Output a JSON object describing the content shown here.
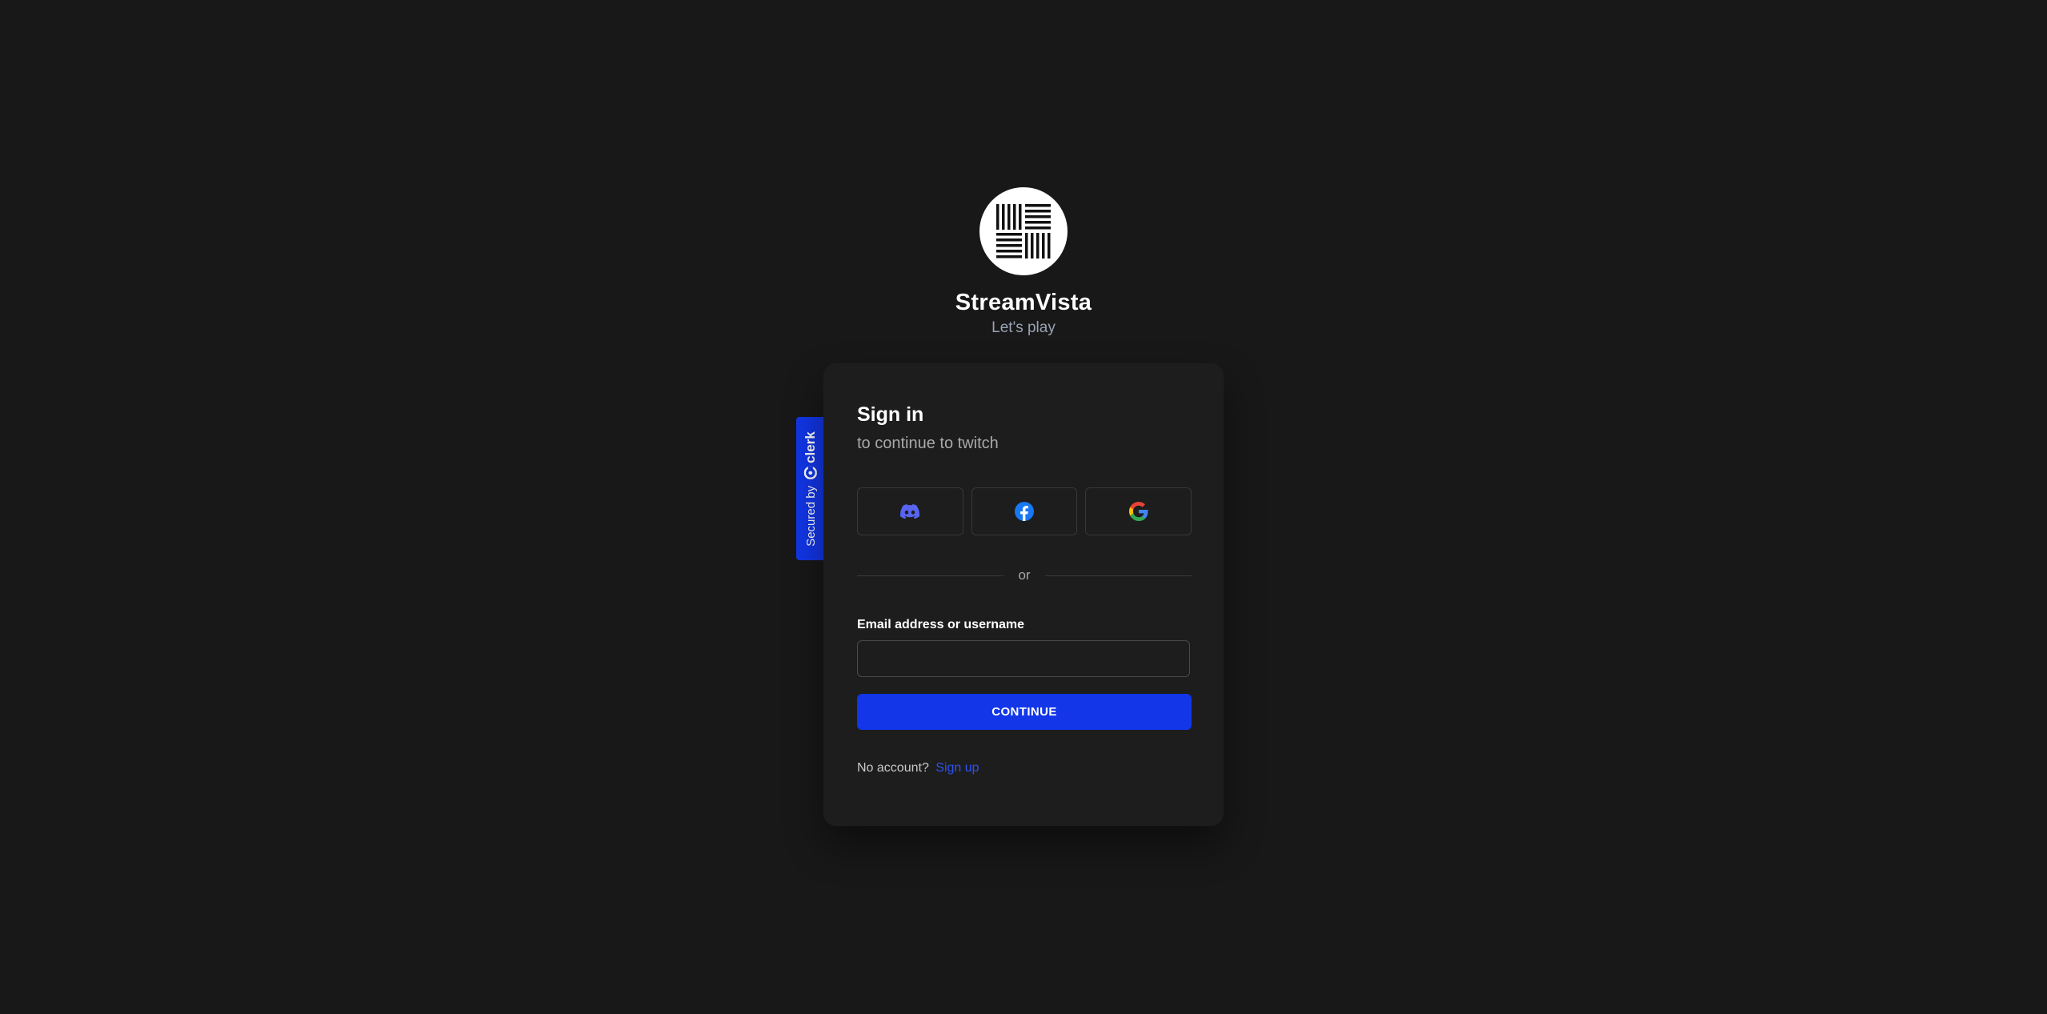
{
  "app": {
    "name": "StreamVista",
    "tagline": "Let's play",
    "logo_icon": "striped-squares-logo"
  },
  "security_badge": {
    "prefix": "Secured by",
    "brand": "clerk",
    "color": "#1236e8"
  },
  "sign_in": {
    "title": "Sign in",
    "subtitle": "to continue to twitch",
    "social_providers": [
      {
        "name": "Discord",
        "icon": "discord-icon",
        "color": "#5865f2"
      },
      {
        "name": "Facebook",
        "icon": "facebook-icon",
        "color": "#1877f2"
      },
      {
        "name": "Google",
        "icon": "google-icon",
        "color": "#4285f4"
      }
    ],
    "divider_text": "or",
    "email_label": "Email address or username",
    "email_value": "",
    "email_placeholder": "",
    "continue_label": "CONTINUE",
    "no_account_text": "No account?",
    "sign_up_link": "Sign up"
  },
  "colors": {
    "background": "#181818",
    "card": "#1d1d1d",
    "accent": "#1236e8",
    "link": "#2f52f0",
    "muted_text": "#a9a9a9"
  }
}
